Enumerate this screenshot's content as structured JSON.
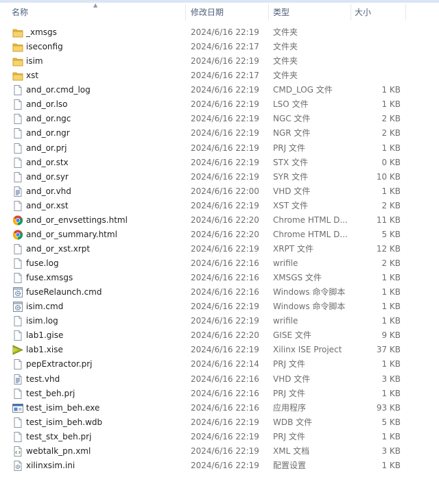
{
  "columns": {
    "name": "名称",
    "date": "修改日期",
    "type": "类型",
    "size": "大小"
  },
  "files": [
    {
      "name": "_xmsgs",
      "date": "2024/6/16 22:19",
      "type": "文件夹",
      "size": "",
      "icon": "folder-icon"
    },
    {
      "name": "iseconfig",
      "date": "2024/6/16 22:17",
      "type": "文件夹",
      "size": "",
      "icon": "folder-icon"
    },
    {
      "name": "isim",
      "date": "2024/6/16 22:19",
      "type": "文件夹",
      "size": "",
      "icon": "folder-icon"
    },
    {
      "name": "xst",
      "date": "2024/6/16 22:17",
      "type": "文件夹",
      "size": "",
      "icon": "folder-icon"
    },
    {
      "name": "and_or.cmd_log",
      "date": "2024/6/16 22:19",
      "type": "CMD_LOG 文件",
      "size": "1 KB",
      "icon": "file-icon"
    },
    {
      "name": "and_or.lso",
      "date": "2024/6/16 22:19",
      "type": "LSO 文件",
      "size": "1 KB",
      "icon": "file-icon"
    },
    {
      "name": "and_or.ngc",
      "date": "2024/6/16 22:19",
      "type": "NGC 文件",
      "size": "2 KB",
      "icon": "file-icon"
    },
    {
      "name": "and_or.ngr",
      "date": "2024/6/16 22:19",
      "type": "NGR 文件",
      "size": "2 KB",
      "icon": "file-icon"
    },
    {
      "name": "and_or.prj",
      "date": "2024/6/16 22:19",
      "type": "PRJ 文件",
      "size": "1 KB",
      "icon": "file-icon"
    },
    {
      "name": "and_or.stx",
      "date": "2024/6/16 22:19",
      "type": "STX 文件",
      "size": "0 KB",
      "icon": "file-icon"
    },
    {
      "name": "and_or.syr",
      "date": "2024/6/16 22:19",
      "type": "SYR 文件",
      "size": "10 KB",
      "icon": "file-icon"
    },
    {
      "name": "and_or.vhd",
      "date": "2024/6/16 22:00",
      "type": "VHD 文件",
      "size": "1 KB",
      "icon": "text-file-icon"
    },
    {
      "name": "and_or.xst",
      "date": "2024/6/16 22:19",
      "type": "XST 文件",
      "size": "2 KB",
      "icon": "file-icon"
    },
    {
      "name": "and_or_envsettings.html",
      "date": "2024/6/16 22:20",
      "type": "Chrome HTML D...",
      "size": "11 KB",
      "icon": "chrome-icon"
    },
    {
      "name": "and_or_summary.html",
      "date": "2024/6/16 22:20",
      "type": "Chrome HTML D...",
      "size": "5 KB",
      "icon": "chrome-icon"
    },
    {
      "name": "and_or_xst.xrpt",
      "date": "2024/6/16 22:19",
      "type": "XRPT 文件",
      "size": "12 KB",
      "icon": "file-icon"
    },
    {
      "name": "fuse.log",
      "date": "2024/6/16 22:16",
      "type": "wrifile",
      "size": "2 KB",
      "icon": "file-icon"
    },
    {
      "name": "fuse.xmsgs",
      "date": "2024/6/16 22:16",
      "type": "XMSGS 文件",
      "size": "1 KB",
      "icon": "file-icon"
    },
    {
      "name": "fuseRelaunch.cmd",
      "date": "2024/6/16 22:16",
      "type": "Windows 命令脚本",
      "size": "1 KB",
      "icon": "gear-file-icon"
    },
    {
      "name": "isim.cmd",
      "date": "2024/6/16 22:19",
      "type": "Windows 命令脚本",
      "size": "1 KB",
      "icon": "gear-file-icon"
    },
    {
      "name": "isim.log",
      "date": "2024/6/16 22:19",
      "type": "wrifile",
      "size": "1 KB",
      "icon": "file-icon"
    },
    {
      "name": "lab1.gise",
      "date": "2024/6/16 22:20",
      "type": "GISE 文件",
      "size": "9 KB",
      "icon": "file-icon"
    },
    {
      "name": "lab1.xise",
      "date": "2024/6/16 22:19",
      "type": "Xilinx ISE Project",
      "size": "37 KB",
      "icon": "xilinx-icon"
    },
    {
      "name": "pepExtractor.prj",
      "date": "2024/6/16 22:14",
      "type": "PRJ 文件",
      "size": "1 KB",
      "icon": "file-icon"
    },
    {
      "name": "test.vhd",
      "date": "2024/6/16 22:16",
      "type": "VHD 文件",
      "size": "3 KB",
      "icon": "text-file-icon"
    },
    {
      "name": "test_beh.prj",
      "date": "2024/6/16 22:16",
      "type": "PRJ 文件",
      "size": "1 KB",
      "icon": "file-icon"
    },
    {
      "name": "test_isim_beh.exe",
      "date": "2024/6/16 22:16",
      "type": "应用程序",
      "size": "93 KB",
      "icon": "exe-icon"
    },
    {
      "name": "test_isim_beh.wdb",
      "date": "2024/6/16 22:19",
      "type": "WDB 文件",
      "size": "5 KB",
      "icon": "file-icon"
    },
    {
      "name": "test_stx_beh.prj",
      "date": "2024/6/16 22:19",
      "type": "PRJ 文件",
      "size": "1 KB",
      "icon": "file-icon"
    },
    {
      "name": "webtalk_pn.xml",
      "date": "2024/6/16 22:19",
      "type": "XML 文档",
      "size": "3 KB",
      "icon": "xml-file-icon"
    },
    {
      "name": "xilinxsim.ini",
      "date": "2024/6/16 22:19",
      "type": "配置设置",
      "size": "1 KB",
      "icon": "ini-file-icon"
    }
  ]
}
